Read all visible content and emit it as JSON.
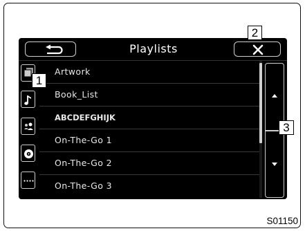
{
  "header": {
    "title": "Playlists",
    "back_icon": "back-arrow-icon",
    "close_icon": "close-icon"
  },
  "sidebar": {
    "items": [
      {
        "icon": "artwork-icon"
      },
      {
        "icon": "music-note-icon"
      },
      {
        "icon": "artist-icon"
      },
      {
        "icon": "disc-icon"
      },
      {
        "icon": "more-icon"
      }
    ]
  },
  "playlists": [
    {
      "label": "Artwork"
    },
    {
      "label": "Book_List"
    },
    {
      "label": "ABCDEFGHIJK"
    },
    {
      "label": "On-The-Go 1"
    },
    {
      "label": "On-The-Go 2"
    },
    {
      "label": "On-The-Go 3"
    }
  ],
  "scroll": {
    "up_icon": "scroll-up-icon",
    "down_icon": "scroll-down-icon"
  },
  "callouts": [
    "1",
    "2",
    "3"
  ],
  "reference_code": "S01150",
  "colors": {
    "screen_bg": "#000000",
    "text": "#e8e8e8",
    "outline": "#cfcfcf",
    "page_bg": "#ffffff"
  }
}
